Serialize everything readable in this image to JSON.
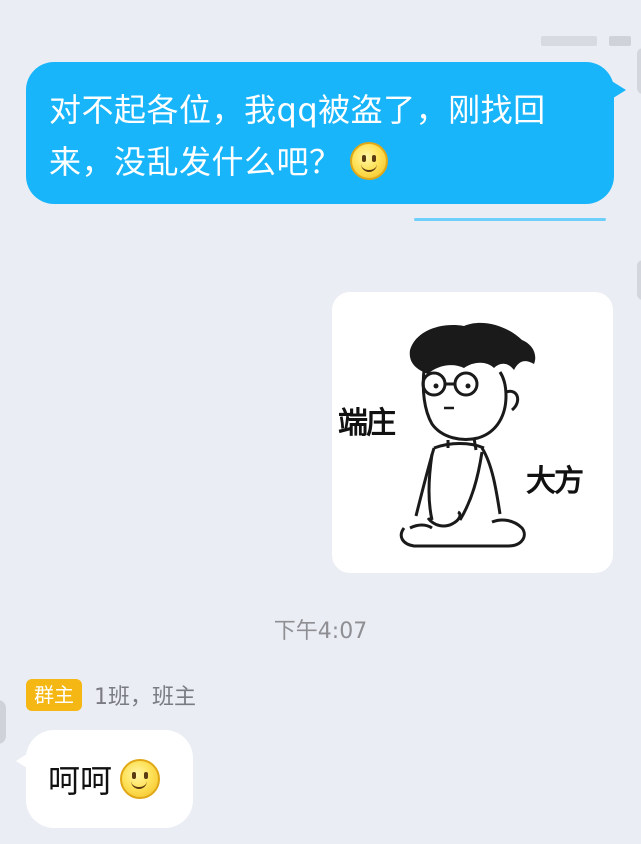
{
  "messages": {
    "outgoing_text": {
      "text": "对不起各位，我qq被盗了，刚找回来，没乱发什么吧？",
      "emoji": "smile-emoji"
    },
    "outgoing_sticker": {
      "left_caption": "端庄",
      "right_caption": "大方"
    },
    "timestamp": "下午4:07",
    "incoming": {
      "badge": "群主",
      "sender": "1班，班主",
      "text": "呵呵",
      "emoji": "smile-emoji"
    }
  },
  "colors": {
    "outgoing_bubble": "#19b5fb",
    "incoming_bubble": "#ffffff",
    "background": "#eaedf4",
    "owner_badge": "#f5b714"
  }
}
